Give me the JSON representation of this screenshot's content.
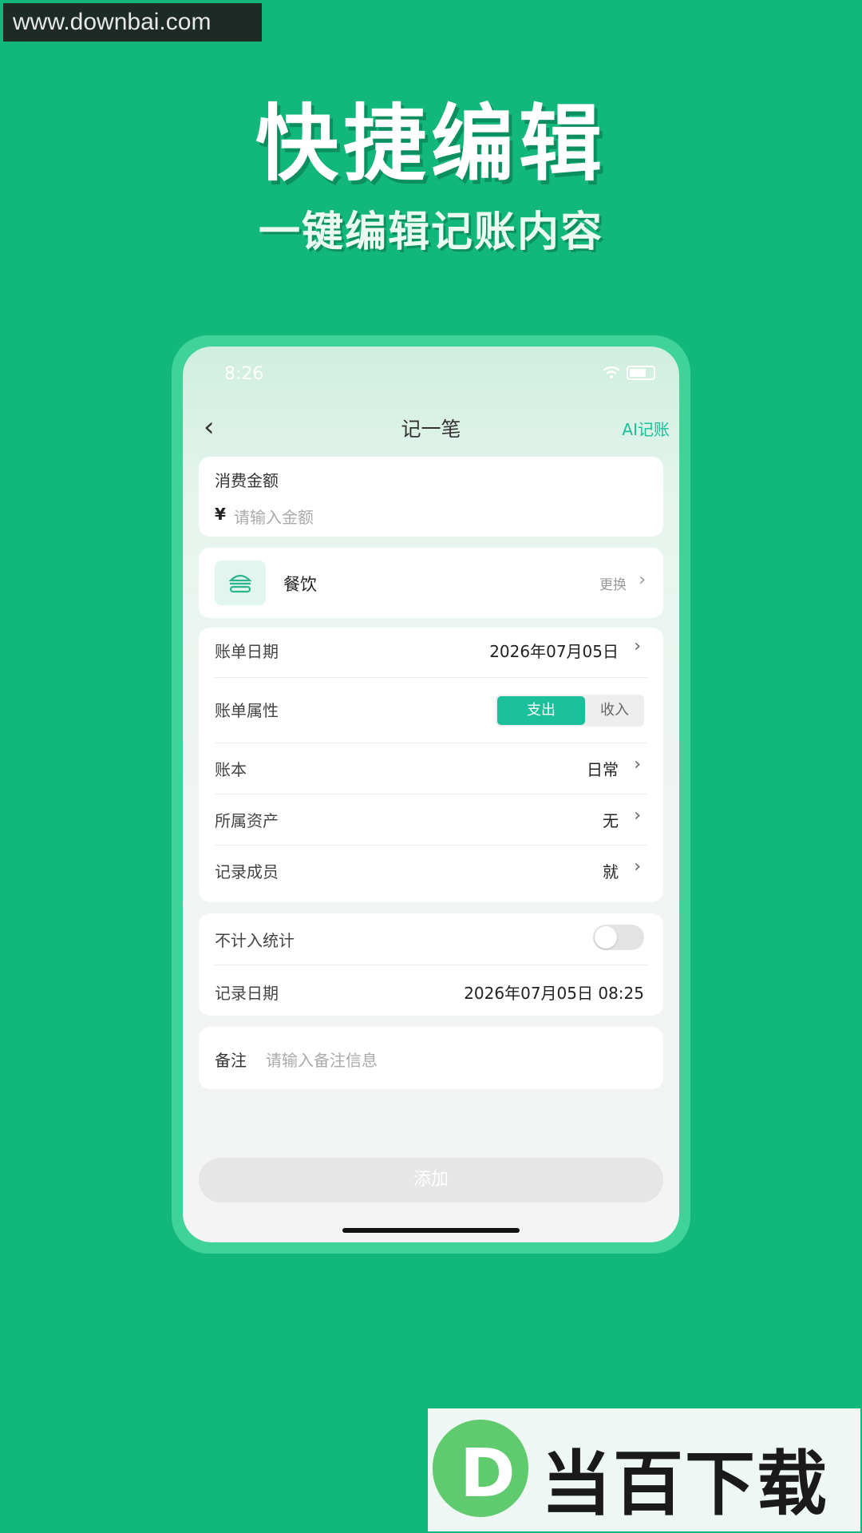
{
  "watermark": "www.downbai.com",
  "promo": {
    "title": "快捷编辑",
    "subtitle": "一键编辑记账内容"
  },
  "status_bar": {
    "time": "8:26"
  },
  "nav": {
    "title": "记一笔",
    "ai_label": "AI记账"
  },
  "amount": {
    "label": "消费金额",
    "currency": "¥",
    "placeholder": "请输入金额"
  },
  "category": {
    "name": "餐饮",
    "icon": "burger-icon",
    "change_label": "更换"
  },
  "details": {
    "bill_date_label": "账单日期",
    "bill_date_value": "2026年07月05日",
    "type_label": "账单属性",
    "type_options": [
      "支出",
      "收入"
    ],
    "type_selected": "支出",
    "book_label": "账本",
    "book_value": "日常",
    "asset_label": "所属资产",
    "asset_value": "无",
    "member_label": "记录成员",
    "member_value": "就"
  },
  "stats": {
    "exclude_label": "不计入统计",
    "exclude_on": false,
    "record_date_label": "记录日期",
    "record_date_value": "2026年07月05日 08:25"
  },
  "note": {
    "label": "备注",
    "placeholder": "请输入备注信息"
  },
  "submit_label": "添加",
  "logo_text": "当百下载",
  "logo_letter": "D",
  "colors": {
    "background": "#12b77c",
    "accent": "#1cbf9c",
    "phone_frame": "#3fd39a"
  }
}
